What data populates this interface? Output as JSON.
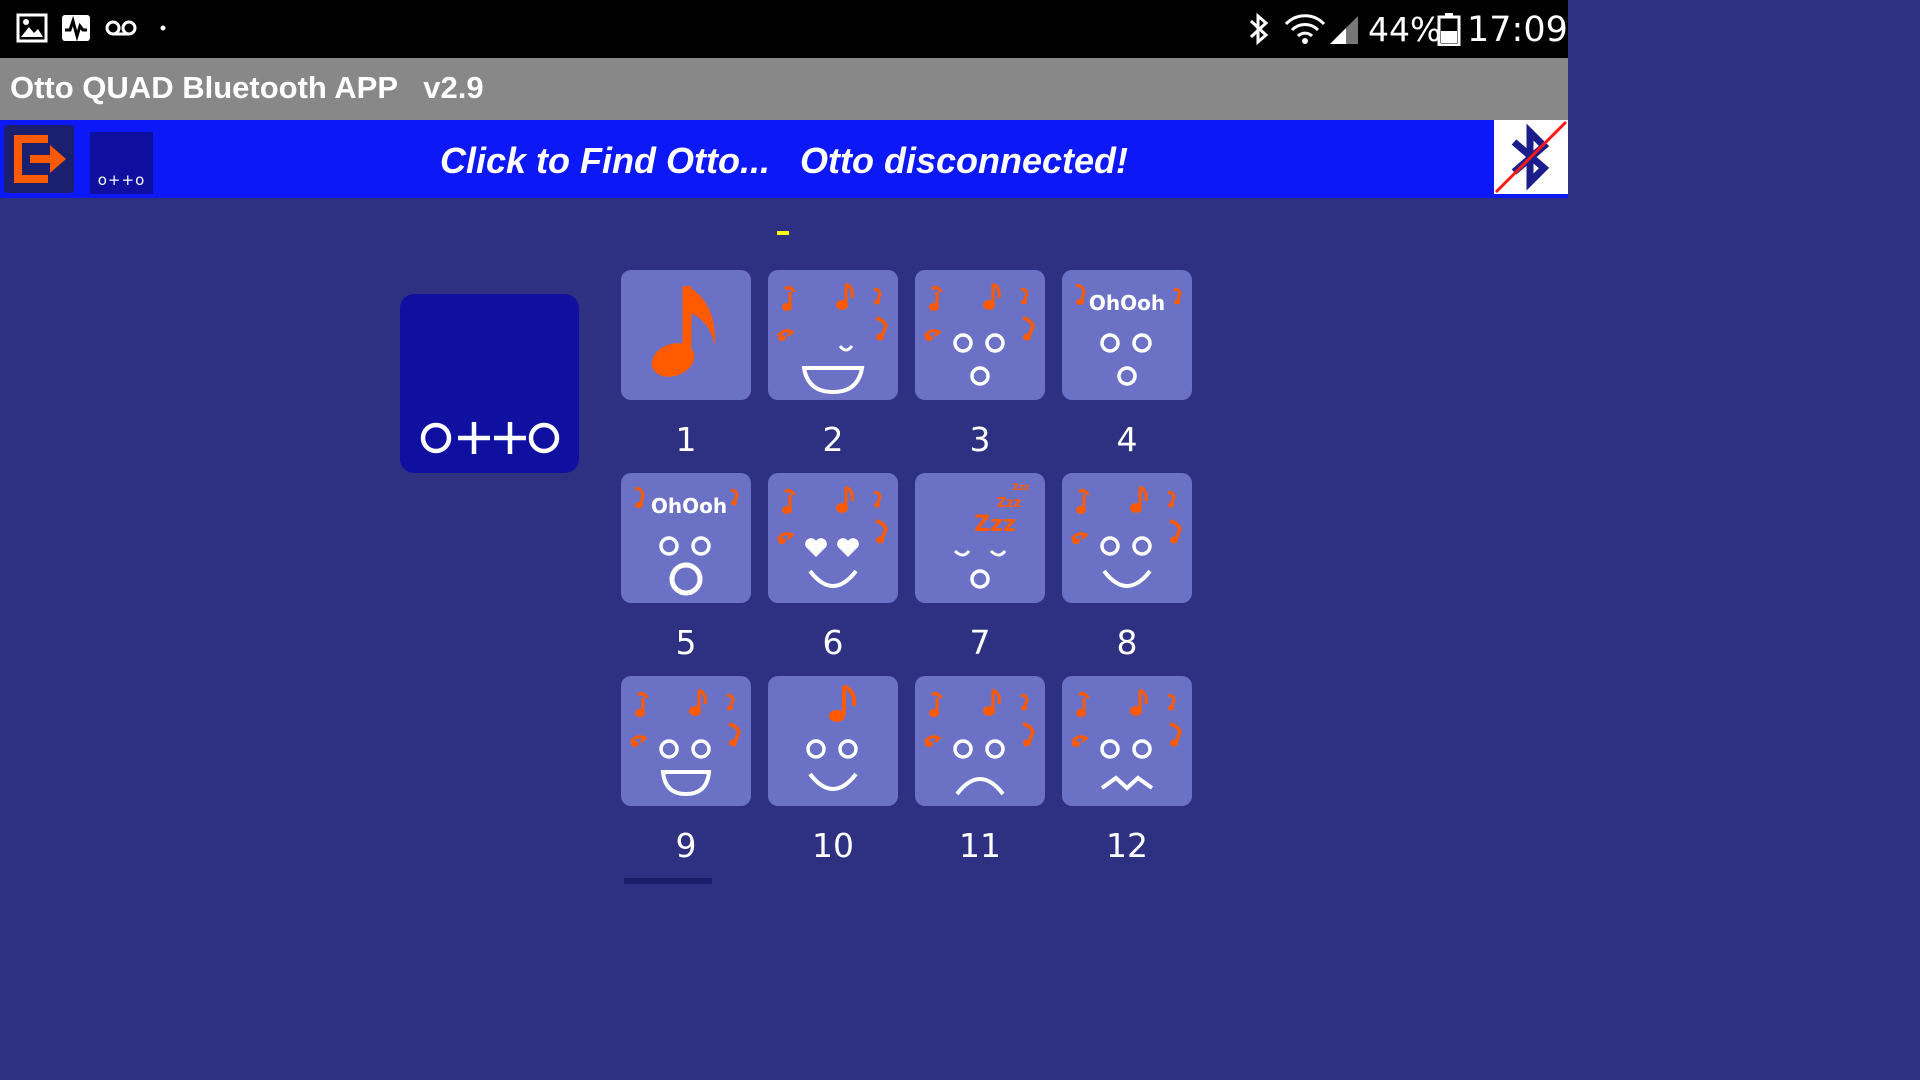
{
  "status_bar": {
    "icons": [
      "gallery-icon",
      "activity-icon",
      "voicemail-icon",
      "dot-icon",
      "bluetooth-icon",
      "wifi-icon",
      "signal-icon",
      "battery-icon"
    ],
    "battery_text": "44%",
    "time": "17:09"
  },
  "app": {
    "title": "Otto QUAD Bluetooth APP   v2.9"
  },
  "header": {
    "find_text": "Click to Find Otto...",
    "connection_text": "Otto disconnected!",
    "logo_small_text": "o++o",
    "accent_color": "#0d18f7",
    "exit_icon_color": "#ff5a00"
  },
  "main": {
    "logo_big_text": "o++o",
    "tiles": [
      {
        "label": "1",
        "icon": "music-note-icon"
      },
      {
        "label": "2",
        "icon": "face-laugh-music-icon"
      },
      {
        "label": "3",
        "icon": "face-surprised-music-icon"
      },
      {
        "label": "4",
        "icon": "face-ohooh-icon"
      },
      {
        "label": "5",
        "icon": "face-ohooh-open-mouth-icon"
      },
      {
        "label": "6",
        "icon": "face-love-music-icon"
      },
      {
        "label": "7",
        "icon": "face-sleeping-icon"
      },
      {
        "label": "8",
        "icon": "face-happy-music-icon"
      },
      {
        "label": "9",
        "icon": "face-big-smile-music-icon"
      },
      {
        "label": "10",
        "icon": "face-smile-note-icon"
      },
      {
        "label": "11",
        "icon": "face-sad-music-icon"
      },
      {
        "label": "12",
        "icon": "face-confused-music-icon"
      }
    ],
    "tile_text": {
      "ohooh_4": "OhOoh",
      "ohooh_5": "OhOoh",
      "zzz": "Zzz"
    }
  }
}
